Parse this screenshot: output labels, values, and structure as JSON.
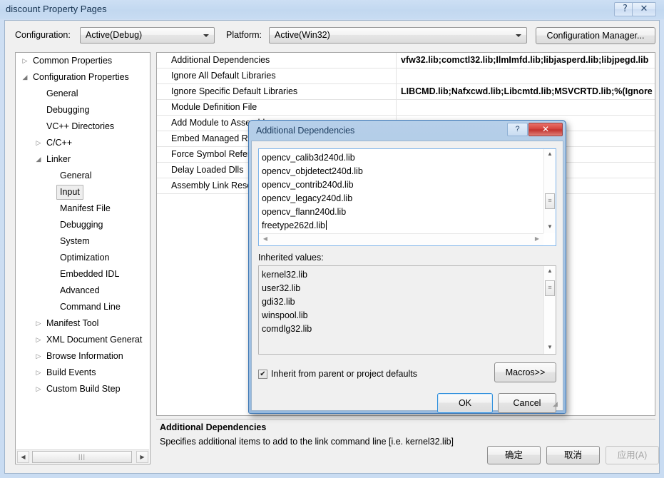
{
  "window": {
    "title": "discount Property Pages",
    "caption_buttons": [
      {
        "name": "help-button",
        "glyph": "?"
      },
      {
        "name": "close-button",
        "glyph": "✕"
      }
    ]
  },
  "config_row": {
    "configuration_label": "Configuration:",
    "configuration_value": "Active(Debug)",
    "platform_label": "Platform:",
    "platform_value": "Active(Win32)",
    "configuration_manager_label": "Configuration Manager..."
  },
  "tree": {
    "items": [
      {
        "label": "Common Properties",
        "indent": 0,
        "twisty": "collapsed",
        "selected": false
      },
      {
        "label": "Configuration Properties",
        "indent": 0,
        "twisty": "expanded",
        "selected": false
      },
      {
        "label": "General",
        "indent": 1,
        "twisty": "none",
        "selected": false
      },
      {
        "label": "Debugging",
        "indent": 1,
        "twisty": "none",
        "selected": false
      },
      {
        "label": "VC++ Directories",
        "indent": 1,
        "twisty": "none",
        "selected": false
      },
      {
        "label": "C/C++",
        "indent": 1,
        "twisty": "collapsed",
        "selected": false
      },
      {
        "label": "Linker",
        "indent": 1,
        "twisty": "expanded",
        "selected": false
      },
      {
        "label": "General",
        "indent": 2,
        "twisty": "none",
        "selected": false
      },
      {
        "label": "Input",
        "indent": 2,
        "twisty": "none",
        "selected": true
      },
      {
        "label": "Manifest File",
        "indent": 2,
        "twisty": "none",
        "selected": false
      },
      {
        "label": "Debugging",
        "indent": 2,
        "twisty": "none",
        "selected": false
      },
      {
        "label": "System",
        "indent": 2,
        "twisty": "none",
        "selected": false
      },
      {
        "label": "Optimization",
        "indent": 2,
        "twisty": "none",
        "selected": false
      },
      {
        "label": "Embedded IDL",
        "indent": 2,
        "twisty": "none",
        "selected": false
      },
      {
        "label": "Advanced",
        "indent": 2,
        "twisty": "none",
        "selected": false
      },
      {
        "label": "Command Line",
        "indent": 2,
        "twisty": "none",
        "selected": false
      },
      {
        "label": "Manifest Tool",
        "indent": 1,
        "twisty": "collapsed",
        "selected": false
      },
      {
        "label": "XML Document Generat",
        "indent": 1,
        "twisty": "collapsed",
        "selected": false
      },
      {
        "label": "Browse Information",
        "indent": 1,
        "twisty": "collapsed",
        "selected": false
      },
      {
        "label": "Build Events",
        "indent": 1,
        "twisty": "collapsed",
        "selected": false
      },
      {
        "label": "Custom Build Step",
        "indent": 1,
        "twisty": "collapsed",
        "selected": false
      }
    ]
  },
  "grid": {
    "rows": [
      {
        "name": "Additional Dependencies",
        "value": "vfw32.lib;comctl32.lib;IlmImfd.lib;libjasperd.lib;libjpegd.lib"
      },
      {
        "name": "Ignore All Default Libraries",
        "value": ""
      },
      {
        "name": "Ignore Specific Default Libraries",
        "value": "LIBCMD.lib;Nafxcwd.lib;Libcmtd.lib;MSVCRTD.lib;%(Ignore"
      },
      {
        "name": "Module Definition File",
        "value": ""
      },
      {
        "name": "Add Module to Assembly",
        "value": ""
      },
      {
        "name": "Embed Managed Resource File",
        "value": ""
      },
      {
        "name": "Force Symbol References",
        "value": ""
      },
      {
        "name": "Delay Loaded Dlls",
        "value": ""
      },
      {
        "name": "Assembly Link Resource",
        "value": ""
      }
    ]
  },
  "description": {
    "title": "Additional Dependencies",
    "body": "Specifies additional items to add to the link command line [i.e. kernel32.lib]"
  },
  "footer": {
    "ok_label": "确定",
    "cancel_label": "取消",
    "apply_label": "应用(A)"
  },
  "dialog": {
    "title": "Additional Dependencies",
    "help_glyph": "?",
    "close_glyph": "✕",
    "edit_lines": [
      "opencv_calib3d240d.lib",
      "opencv_objdetect240d.lib",
      "opencv_contrib240d.lib",
      "opencv_legacy240d.lib",
      "opencv_flann240d.lib",
      "freetype262d.lib"
    ],
    "inherited_label": "Inherited values:",
    "inherited_values": [
      "kernel32.lib",
      "user32.lib",
      "gdi32.lib",
      "winspool.lib",
      "comdlg32.lib"
    ],
    "inherit_checkbox_label": "Inherit from parent or project defaults",
    "inherit_checkbox_checked": "✔",
    "macros_label": "Macros>>",
    "ok_label": "OK",
    "cancel_label": "Cancel"
  },
  "colors": {
    "window_frame": "#cfdff3",
    "dialog_title": "#96b9de",
    "accent_blue": "#3f78b5",
    "close_red": "#d2403a",
    "focus_border": "#7eb4ea"
  }
}
